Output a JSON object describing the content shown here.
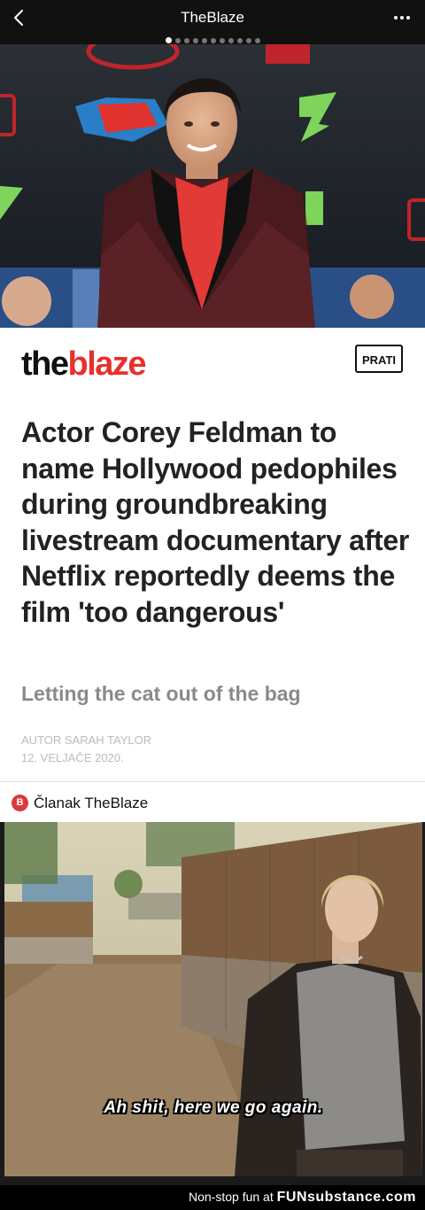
{
  "topbar": {
    "title": "TheBlaze",
    "back_icon": "chevron-left-icon",
    "more_icon": "more-dots-icon",
    "page_dots_total": 11,
    "page_dots_active_index": 0
  },
  "article": {
    "follow_label": "PRATI",
    "logo": {
      "the": "the",
      "blaze": "blaze"
    },
    "headline": "Actor Corey Feldman to name Hollywood pedophiles during groundbreaking livestream documentary after Netflix reportedly deems the film 'too dangerous'",
    "subtitle": "Letting the cat out of the bag",
    "author": "AUTOR SARAH TAYLOR",
    "date": "12. VELJAČE 2020."
  },
  "source": {
    "label": "Članak TheBlaze",
    "icon": "theblaze-logo-icon"
  },
  "meme": {
    "caption": "Ah shit, here we go again."
  },
  "footer": {
    "prefix": "Non-stop fun at",
    "brand": "FUNsubstance.com"
  },
  "colors": {
    "brand_red": "#e8302b",
    "headline": "#222222",
    "subtitle": "#8a8a8a",
    "meta": "#bbbbbb"
  }
}
